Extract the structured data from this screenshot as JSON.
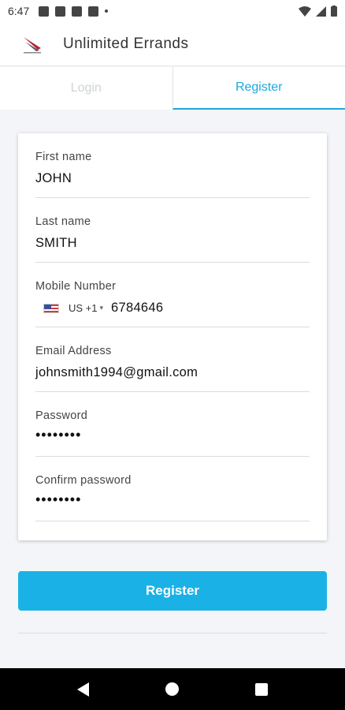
{
  "status_bar": {
    "time": "6:47"
  },
  "app_bar": {
    "title": "Unlimited Errands"
  },
  "tabs": [
    {
      "label": "Login"
    },
    {
      "label": "Register"
    }
  ],
  "form": {
    "first_name": {
      "label": "First name",
      "value": "JOHN"
    },
    "last_name": {
      "label": "Last name",
      "value": "SMITH"
    },
    "mobile": {
      "label": "Mobile Number",
      "country": "US +1",
      "number": "6784646"
    },
    "email": {
      "label": "Email Address",
      "value": "johnsmith1994@gmail.com"
    },
    "password": {
      "label": "Password",
      "value": "••••••••"
    },
    "confirm_password": {
      "label": "Confirm password",
      "value": "••••••••"
    }
  },
  "register_button": {
    "label": "Register"
  },
  "colors": {
    "accent": "#1ab2e6",
    "tab_active": "#1aa9e0",
    "tab_inactive": "#cfd3d6"
  },
  "icons": {
    "status": [
      "settings-icon",
      "mail-icon",
      "shield-icon",
      "sd-card-icon",
      "dot-icon",
      "wifi-icon",
      "signal-icon",
      "battery-icon"
    ],
    "nav": [
      "back-icon",
      "home-icon",
      "recent-apps-icon"
    ]
  }
}
